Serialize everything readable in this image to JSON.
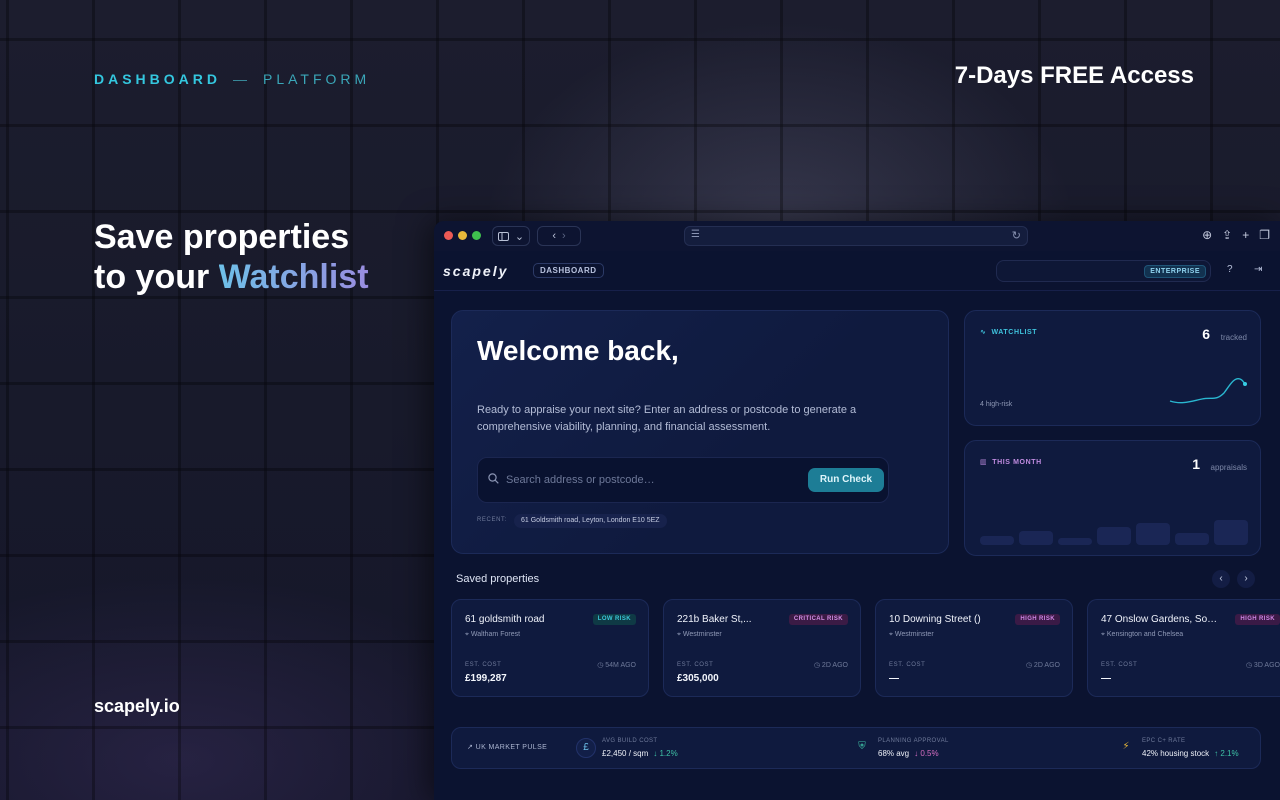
{
  "overline": {
    "primary": "DASHBOARD",
    "dash": "—",
    "secondary": "PLATFORM"
  },
  "promo": "7-Days FREE Access",
  "headline": {
    "line1": "Save properties",
    "line2_prefix": "to your ",
    "line2_highlight": "Watchlist"
  },
  "site": "scapely.io",
  "browser": {
    "app": {
      "logo": "scapely",
      "section_pill": "DASHBOARD",
      "plan": "ENTERPRISE"
    },
    "welcome": {
      "title": "Welcome back,",
      "description": "Ready to appraise your next site? Enter an address or postcode to generate a comprehensive viability, planning, and financial assessment.",
      "search_placeholder": "Search address or postcode…",
      "run_label": "Run Check",
      "recent_label": "RECENT:",
      "recent_item": "61 Goldsmith road, Leyton, London E10 5EZ"
    },
    "watchlist": {
      "title": "WATCHLIST",
      "count": "6",
      "unit": "tracked",
      "sub": "4 high-risk"
    },
    "this_month": {
      "title": "THIS MONTH",
      "count": "1",
      "unit": "appraisals",
      "bar_levels": [
        0.22,
        0.34,
        0.18,
        0.45,
        0.55,
        0.3,
        0.62
      ]
    },
    "saved": {
      "title": "Saved properties",
      "properties": [
        {
          "name": "61 goldsmith road",
          "location": "Waltham Forest",
          "risk": "LOW RISK",
          "cost_label": "EST. COST",
          "ago": "54M AGO",
          "cost": "£199,287"
        },
        {
          "name": "221b Baker St,...",
          "location": "Westminster",
          "risk": "CRITICAL RISK",
          "cost_label": "EST. COST",
          "ago": "2D AGO",
          "cost": "£305,000"
        },
        {
          "name": "10 Downing Street ()",
          "location": "Westminster",
          "risk": "HIGH RISK",
          "cost_label": "EST. COST",
          "ago": "2D AGO",
          "cost": "—"
        },
        {
          "name": "47 Onslow Gardens, Sou...",
          "location": "Kensington and Chelsea",
          "risk": "HIGH RISK",
          "cost_label": "EST. COST",
          "ago": "3D AGO",
          "cost": "—"
        }
      ]
    },
    "pulse": {
      "label": "UK MARKET PULSE",
      "metrics": [
        {
          "label": "AVG BUILD COST",
          "value": "£2,450 / sqm",
          "change": "↓ 1.2%",
          "icon": "pound-icon",
          "glyph": "£"
        },
        {
          "label": "PLANNING APPROVAL",
          "value": "68% avg",
          "change": "↓ 0.5%",
          "icon": "shield-icon",
          "glyph": "⛨"
        },
        {
          "label": "EPC C+ RATE",
          "value": "42% housing stock",
          "change": "↑ 2.1%",
          "icon": "bolt-icon",
          "glyph": "⚡"
        }
      ]
    },
    "colors": {
      "accent_cyan": "#34c7df",
      "accent_purple": "#c08ce0",
      "run_button": "#1d7d96"
    }
  }
}
